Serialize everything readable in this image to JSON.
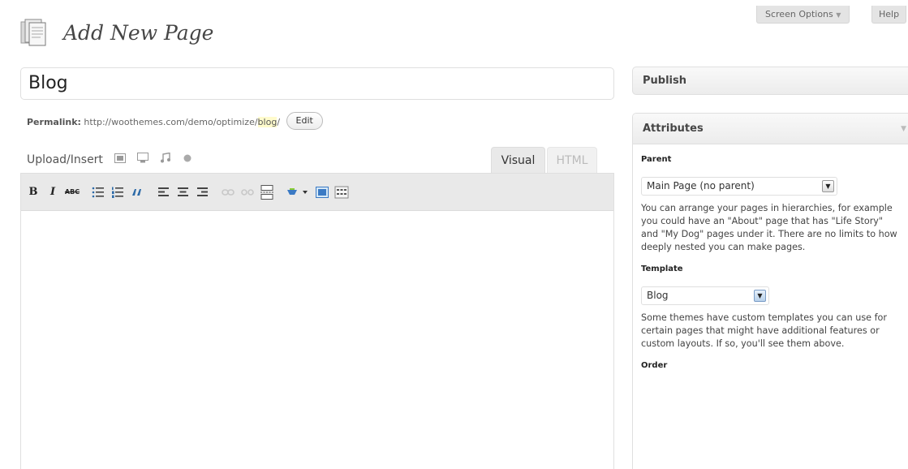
{
  "header": {
    "title": "Add New Page",
    "screen_options": "Screen Options",
    "help": "Help"
  },
  "post": {
    "title_value": "Blog",
    "permalink_label": "Permalink:",
    "permalink_base": "http://woothemes.com/demo/optimize/",
    "permalink_slug": "blog",
    "permalink_trailing": "/",
    "edit_label": "Edit"
  },
  "editor": {
    "upload_label": "Upload/Insert",
    "media_icons": [
      "add-image-icon",
      "add-video-icon",
      "add-audio-icon",
      "add-media-icon"
    ],
    "tab_visual": "Visual",
    "tab_html": "HTML",
    "toolbar": {
      "bold": "B",
      "italic": "I",
      "strike": "ABC",
      "items": [
        "bold-icon",
        "italic-icon",
        "strikethrough-icon",
        "bullet-list-icon",
        "numbered-list-icon",
        "blockquote-icon",
        "align-left-icon",
        "align-center-icon",
        "align-right-icon",
        "link-icon",
        "unlink-icon",
        "more-tag-icon",
        "spellcheck-icon",
        "fullscreen-icon",
        "kitchen-sink-icon"
      ]
    }
  },
  "sidebar": {
    "publish_title": "Publish",
    "attributes_title": "Attributes",
    "parent_label": "Parent",
    "parent_value": "Main Page (no parent)",
    "parent_help": "You can arrange your pages in hierarchies, for example you could have an \"About\" page that has \"Life Story\" and \"My Dog\" pages under it. There are no limits to how deeply nested you can make pages.",
    "template_label": "Template",
    "template_value": "Blog",
    "template_help": "Some themes have custom templates you can use for certain pages that might have additional features or custom layouts. If so, you'll see them above.",
    "order_label": "Order"
  },
  "colors": {
    "accent": "#21759b",
    "toolbar_bg": "#e9e9e9",
    "slug_highlight": "#fffbcc"
  }
}
